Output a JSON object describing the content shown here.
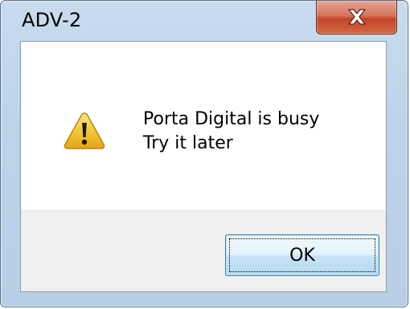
{
  "window": {
    "title": "ADV-2",
    "close_icon": "close-x-icon",
    "close_button_color": "#c7432a"
  },
  "dialog": {
    "icon": "warning-icon",
    "icon_color": "#f3c534",
    "message_line_1": "Porta Digital is busy",
    "message_line_2": "Try it later"
  },
  "buttons": {
    "ok_label": "OK"
  }
}
